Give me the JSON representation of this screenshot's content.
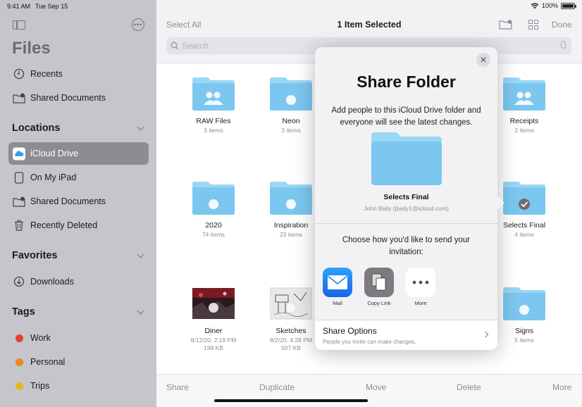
{
  "status": {
    "time": "9:41 AM",
    "date": "Tue Sep 15",
    "battery": "100%"
  },
  "sidebar": {
    "title": "Files",
    "top_items": [
      {
        "label": "Recents",
        "icon": "clock-icon"
      },
      {
        "label": "Shared Documents",
        "icon": "shared-folder-icon"
      }
    ],
    "locations": {
      "label": "Locations",
      "items": [
        {
          "label": "iCloud Drive",
          "icon": "icloud-icon",
          "active": true
        },
        {
          "label": "On My iPad",
          "icon": "ipad-icon"
        },
        {
          "label": "Shared Documents",
          "icon": "shared-folder-icon"
        },
        {
          "label": "Recently Deleted",
          "icon": "trash-icon"
        }
      ]
    },
    "favorites": {
      "label": "Favorites",
      "items": [
        {
          "label": "Downloads",
          "icon": "download-icon"
        }
      ]
    },
    "tags": {
      "label": "Tags",
      "items": [
        {
          "label": "Work",
          "color": "#e5432d"
        },
        {
          "label": "Personal",
          "color": "#e98a1b"
        },
        {
          "label": "Trips",
          "color": "#e6b61a"
        }
      ]
    }
  },
  "topbar": {
    "select_all": "Select All",
    "title": "1 Item Selected",
    "done": "Done",
    "search_placeholder": "Search"
  },
  "files": [
    {
      "name": "RAW Files",
      "meta": "3 items",
      "kind": "shared-folder"
    },
    {
      "name": "Neon",
      "meta": "3 items",
      "kind": "folder"
    },
    {
      "name": "Receipts",
      "meta": "2 items",
      "kind": "shared-folder"
    },
    {
      "name": "2020",
      "meta": "74 items",
      "kind": "folder"
    },
    {
      "name": "Inspiration",
      "meta": "23 items",
      "kind": "folder"
    },
    {
      "name": "Selects Final",
      "meta": "4 items",
      "kind": "folder-selected"
    },
    {
      "name": "Diner",
      "meta": "8/12/20, 2:19 PM",
      "meta2": "198 KB",
      "kind": "photo"
    },
    {
      "name": "Sketches",
      "meta": "8/2/20, 4:28 PM",
      "meta2": "507 KB",
      "kind": "sketch"
    },
    {
      "name": "Signs",
      "meta": "5 items",
      "kind": "folder"
    }
  ],
  "toolbar": {
    "share": "Share",
    "duplicate": "Duplicate",
    "move": "Move",
    "delete": "Delete",
    "more": "More"
  },
  "popover": {
    "title": "Share Folder",
    "description": "Add people to this iCloud Drive folder and everyone will see the latest changes.",
    "folder_name": "Selects Final",
    "folder_owner": "John Baily (jbaily1@icloud.com)",
    "choose_text": "Choose how you'd like to send your invitation:",
    "apps": [
      {
        "label": "Mail",
        "icon": "mail-icon"
      },
      {
        "label": "Copy Link",
        "icon": "copy-link-icon"
      },
      {
        "label": "More",
        "icon": "more-icon"
      }
    ],
    "share_options": {
      "title": "Share Options",
      "subtitle": "People you invite can make changes."
    }
  },
  "colors": {
    "folder": "#7cc7ef",
    "folder_tab": "#9ad6f5",
    "mail": "#1a82f0",
    "sidebar_bg": "#c6c5cb"
  }
}
